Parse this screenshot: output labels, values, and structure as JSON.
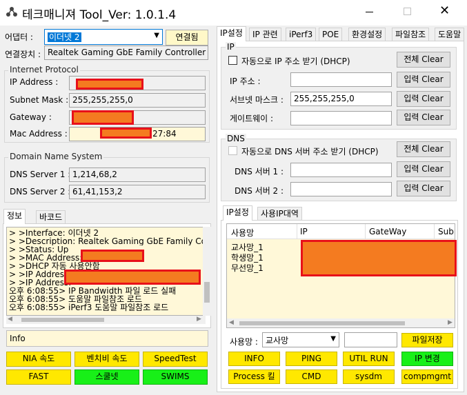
{
  "window": {
    "title": "테크매니져 Tool_Ver: 1.0.1.4",
    "controls": [
      "minimize",
      "maximize",
      "close"
    ]
  },
  "adapter": {
    "label": "어댑터 :",
    "selected": "이더넷 2",
    "connect_button": "연결됨",
    "device_label": "연결장치 :",
    "device_value": "Realtek Gaming GbE Family Controller"
  },
  "ip_group": {
    "title": "Internet Protocol",
    "ip_label": "IP Address :",
    "subnet_label": "Subnet Mask :",
    "subnet_value": "255,255,255,0",
    "gateway_label": "Gateway :",
    "mac_label": "Mac Address :",
    "mac_suffix": "27:84"
  },
  "dns_group": {
    "title": "Domain Name System",
    "dns1_label": "DNS Server 1 :",
    "dns1_value": "1,214,68,2",
    "dns2_label": "DNS Server 2 :",
    "dns2_value": "61,41,153,2"
  },
  "left_tabs": [
    "정보",
    "바코드"
  ],
  "log_lines": [
    "> >Interface: 이더넷 2",
    "> >Description: Realtek Gaming GbE Family Cont",
    "> >Status: Up",
    "> >MAC Address:",
    "> >DHCP 자동 사용안함",
    "> >IP Address:",
    "> >IP Address:",
    "오후 6:08:55> IP Bandwidth 파일 로드 실패",
    "오후 6:08:55> 도움말 파일참조 로드",
    "오후 6:08:55> iPerf3 도움말 파일참조 로드"
  ],
  "info_box": "Info",
  "left_buttons": [
    {
      "label": "NIA 속도",
      "color": "#ffe800"
    },
    {
      "label": "벤치비 속도",
      "color": "#ffe800"
    },
    {
      "label": "SpeedTest",
      "color": "#ffe800"
    },
    {
      "label": "FAST",
      "color": "#ffe800"
    },
    {
      "label": "스쿨넷",
      "color": "#18f018"
    },
    {
      "label": "SWIMS",
      "color": "#18f018"
    }
  ],
  "right_tabs": [
    "IP설정",
    "IP 관련",
    "iPerf3",
    "POE",
    "환경설정",
    "파일참조",
    "도움말"
  ],
  "ip_section": {
    "title": "IP",
    "dhcp_label": "자동으로 IP 주소 받기 (DHCP)",
    "clear_all": "전체 Clear",
    "ip_label": "IP 주소 :",
    "subnet_label": "서브넷 마스크 :",
    "subnet_value": "255,255,255,0",
    "gateway_label": "게이트웨이 :",
    "input_clear": "입력 Clear"
  },
  "dns_section": {
    "title": "DNS",
    "dhcp_label": "자동으로 DNS 서버 주소 받기 (DHCP)",
    "clear_all": "전체 Clear",
    "dns1_label": "DNS 서버 1 :",
    "dns2_label": "DNS 서버 2 :",
    "input_clear": "입력 Clear"
  },
  "bottom_tabs": [
    "IP설정",
    "사용IP대역"
  ],
  "ip_table": {
    "headers": [
      "사용망",
      "IP",
      "GateWay",
      "Subr"
    ],
    "rows": [
      "교사망_1",
      "학생망_1",
      "무선망_1"
    ]
  },
  "network_select": {
    "label": "사용망 :",
    "selected": "교사망",
    "save_button": "파일저장"
  },
  "right_buttons": [
    {
      "label": "INFO",
      "color": "#ffe800"
    },
    {
      "label": "PING",
      "color": "#ffe800"
    },
    {
      "label": "UTIL RUN",
      "color": "#ffe800"
    },
    {
      "label": "IP 변경",
      "color": "#18f018"
    },
    {
      "label": "Process 킬",
      "color": "#ffe800"
    },
    {
      "label": "CMD",
      "color": "#ffe800"
    },
    {
      "label": "sysdm",
      "color": "#ffe800"
    },
    {
      "label": "compmgmt",
      "color": "#ffe800"
    }
  ]
}
